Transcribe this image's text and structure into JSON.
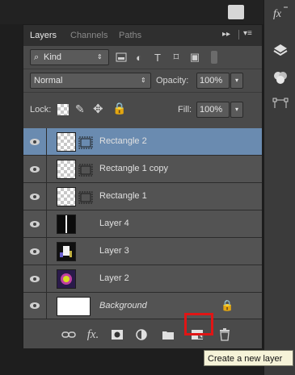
{
  "tabs": [
    "Layers",
    "Channels",
    "Paths"
  ],
  "filter": {
    "label": "Kind"
  },
  "blend": {
    "mode": "Normal",
    "opacity_label": "Opacity:",
    "opacity_value": "100%"
  },
  "lock": {
    "label": "Lock:",
    "fill_label": "Fill:",
    "fill_value": "100%"
  },
  "layers": [
    {
      "name": "Rectangle 2",
      "selected": true
    },
    {
      "name": "Rectangle 1 copy",
      "selected": false
    },
    {
      "name": "Rectangle 1",
      "selected": false
    },
    {
      "name": "Layer 4",
      "selected": false
    },
    {
      "name": "Layer 3",
      "selected": false
    },
    {
      "name": "Layer 2",
      "selected": false
    },
    {
      "name": "Background",
      "selected": false,
      "locked": true
    }
  ],
  "bottom_icons": [
    "link-icon",
    "fx-icon",
    "add-mask-icon",
    "adjustment-icon",
    "new-group-icon",
    "new-layer-icon",
    "trash-icon"
  ],
  "tooltip": "Create a new layer",
  "colors": {
    "selected_row": "#6a8bb0",
    "highlight": "#e01515",
    "tooltip_bg": "#f6f3d8"
  }
}
